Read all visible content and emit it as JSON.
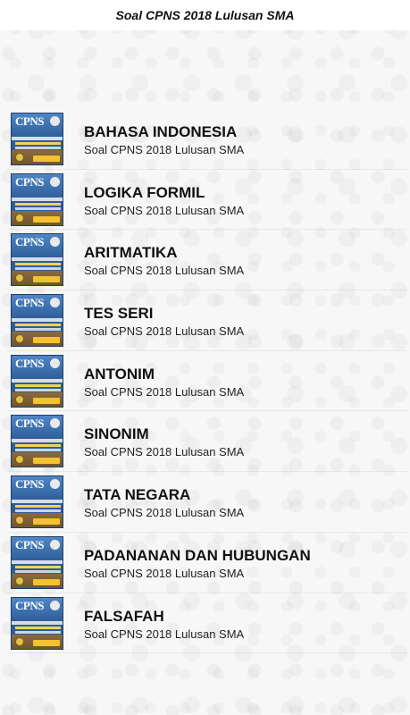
{
  "app_title": "Soal CPNS 2018 Lulusan SMA",
  "items": [
    {
      "title": "BAHASA INDONESIA",
      "subtitle": "Soal CPNS 2018 Lulusan SMA",
      "icon": "cpns-thumbnail-icon"
    },
    {
      "title": "LOGIKA FORMIL",
      "subtitle": "Soal CPNS 2018 Lulusan SMA",
      "icon": "cpns-thumbnail-icon"
    },
    {
      "title": "ARITMATIKA",
      "subtitle": "Soal CPNS 2018 Lulusan SMA",
      "icon": "cpns-thumbnail-icon"
    },
    {
      "title": "TES SERI",
      "subtitle": "Soal CPNS 2018 Lulusan SMA",
      "icon": "cpns-thumbnail-icon"
    },
    {
      "title": "ANTONIM",
      "subtitle": "Soal CPNS 2018 Lulusan SMA",
      "icon": "cpns-thumbnail-icon"
    },
    {
      "title": "SINONIM",
      "subtitle": "Soal CPNS 2018 Lulusan SMA",
      "icon": "cpns-thumbnail-icon"
    },
    {
      "title": "TATA NEGARA",
      "subtitle": "Soal CPNS 2018 Lulusan SMA",
      "icon": "cpns-thumbnail-icon"
    },
    {
      "title": "PADANANAN DAN HUBUNGAN",
      "subtitle": "Soal CPNS 2018 Lulusan SMA",
      "icon": "cpns-thumbnail-icon"
    },
    {
      "title": "FALSAFAH",
      "subtitle": "Soal CPNS 2018 Lulusan SMA",
      "icon": "cpns-thumbnail-icon"
    }
  ],
  "colors": {
    "background": "#f7f7f7",
    "text": "#111111",
    "thumbnail_blue": "#2e5e96"
  }
}
